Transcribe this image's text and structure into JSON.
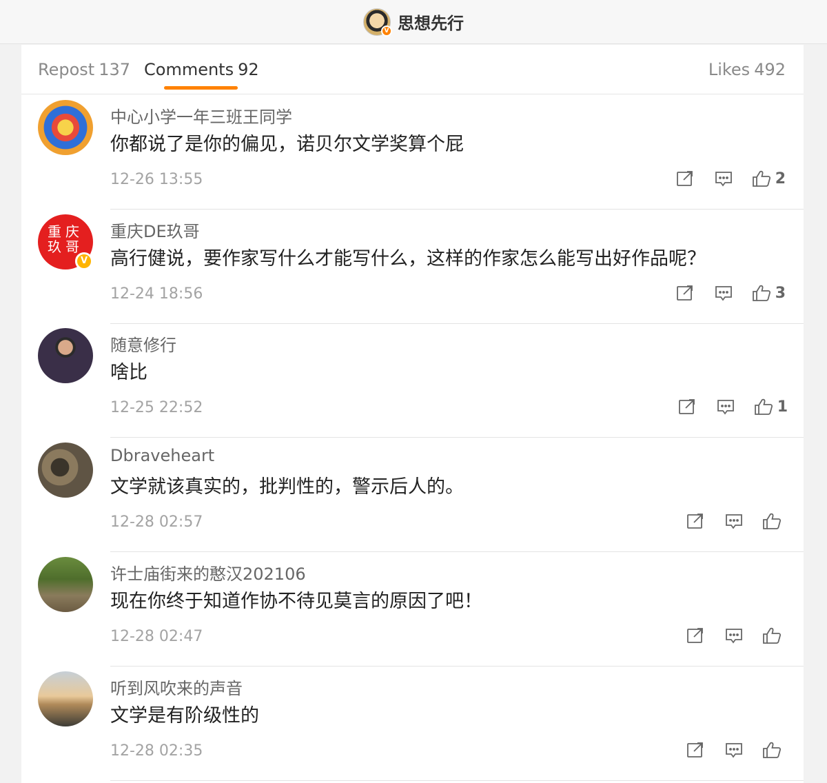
{
  "header": {
    "account_name": "思想先行",
    "verified_badge": "V"
  },
  "tabs": [
    {
      "label": "Repost",
      "count": "137"
    },
    {
      "label": "Comments",
      "count": "92"
    },
    {
      "label": "Likes",
      "count": "492"
    }
  ],
  "icons": {
    "share": "share-icon",
    "reply": "comment-icon",
    "like": "thumbs-up-icon"
  },
  "colors": {
    "accent": "#ff8200",
    "background": "#f2f2f2",
    "panel": "#ffffff"
  },
  "comments": [
    {
      "username": "中心小学一年三班王同学",
      "text": "你都说了是你的偏见，诺贝尔文学奖算个屁",
      "time": "12-26 13:55",
      "likes": "2"
    },
    {
      "username": "重庆DE玖哥",
      "text": "高行健说，要作家写什么才能写什么，这样的作家怎么能写出好作品呢？",
      "time": "12-24 18:56",
      "likes": "3",
      "avatar_text": "重庆玖哥",
      "verified": "V"
    },
    {
      "username": "随意修行",
      "text": "啥比",
      "time": "12-25 22:52",
      "likes": "1"
    },
    {
      "username": "Dbraveheart",
      "text": "文学就该真实的，批判性的，警示后人的。",
      "time": "12-28 02:57",
      "likes": ""
    },
    {
      "username": "许士庙街来的憨汉202106",
      "text": "现在你终于知道作协不待见莫言的原因了吧！",
      "time": "12-28 02:47",
      "likes": ""
    },
    {
      "username": "听到风吹来的声音",
      "text": "文学是有阶级性的",
      "time": "12-28 02:35",
      "likes": ""
    }
  ]
}
